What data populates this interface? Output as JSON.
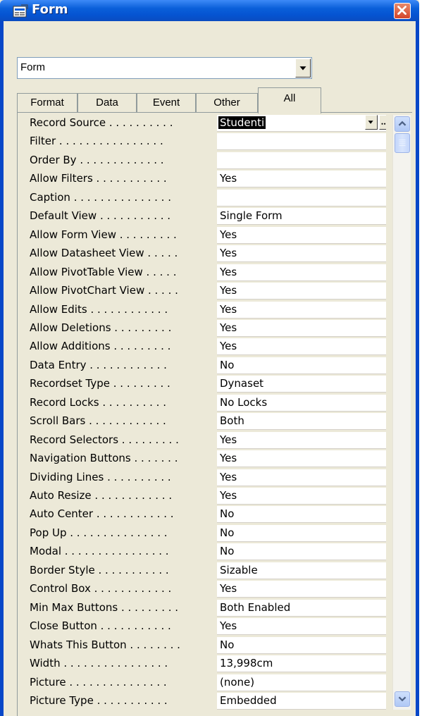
{
  "window": {
    "title": "Form",
    "icon": "form-icon",
    "close_icon": "close-icon"
  },
  "selector": {
    "value": "Form"
  },
  "tabs": [
    {
      "label": "Format",
      "active": false
    },
    {
      "label": "Data",
      "active": false
    },
    {
      "label": "Event",
      "active": false
    },
    {
      "label": "Other",
      "active": false
    },
    {
      "label": "All",
      "active": true
    }
  ],
  "properties": [
    {
      "label": "Record Source . . . . . . . . . .",
      "value": "Studenti",
      "selected": true
    },
    {
      "label": "Filter . . . . . . . . . . . . . . . .",
      "value": ""
    },
    {
      "label": "Order By . . . . . . . . . . . . .",
      "value": ""
    },
    {
      "label": "Allow Filters . . . . . . . . . . .",
      "value": "Yes"
    },
    {
      "label": "Caption . . . . . . . . . . . . . . .",
      "value": ""
    },
    {
      "label": "Default View . . . . . . . . . . .",
      "value": "Single Form"
    },
    {
      "label": "Allow Form View . . . . . . . . .",
      "value": "Yes"
    },
    {
      "label": "Allow Datasheet View . . . . .",
      "value": "Yes"
    },
    {
      "label": "Allow PivotTable View . . . . .",
      "value": "Yes"
    },
    {
      "label": "Allow PivotChart View . . . . .",
      "value": "Yes"
    },
    {
      "label": "Allow Edits . . . . . . . . . . . .",
      "value": "Yes"
    },
    {
      "label": "Allow Deletions . . . . . . . . .",
      "value": "Yes"
    },
    {
      "label": "Allow Additions . . . . . . . . .",
      "value": "Yes"
    },
    {
      "label": "Data Entry . . . . . . . . . . . .",
      "value": "No"
    },
    {
      "label": "Recordset Type . . . . . . . . .",
      "value": "Dynaset"
    },
    {
      "label": "Record Locks . . . . . . . . . .",
      "value": "No Locks"
    },
    {
      "label": "Scroll Bars . . . . . . . . . . . .",
      "value": "Both"
    },
    {
      "label": "Record Selectors . . . . . . . . .",
      "value": "Yes"
    },
    {
      "label": "Navigation Buttons . . . . . . .",
      "value": "Yes"
    },
    {
      "label": "Dividing Lines . . . . . . . . . .",
      "value": "Yes"
    },
    {
      "label": "Auto Resize . . . . . . . . . . . .",
      "value": "Yes"
    },
    {
      "label": "Auto Center . . . . . . . . . . . .",
      "value": "No"
    },
    {
      "label": "Pop Up . . . . . . . . . . . . . . .",
      "value": "No"
    },
    {
      "label": "Modal . . . . . . . . . . . . . . . .",
      "value": "No"
    },
    {
      "label": "Border Style . . . . . . . . . . .",
      "value": "Sizable"
    },
    {
      "label": "Control Box . . . . . . . . . . . .",
      "value": "Yes"
    },
    {
      "label": "Min Max Buttons . . . . . . . . .",
      "value": "Both Enabled"
    },
    {
      "label": "Close Button . . . . . . . . . . .",
      "value": "Yes"
    },
    {
      "label": "Whats This Button . . . . . . . .",
      "value": "No"
    },
    {
      "label": "Width . . . . . . . . . . . . . . . .",
      "value": "13,998cm"
    },
    {
      "label": "Picture . . . . . . . . . . . . . . .",
      "value": "(none)"
    },
    {
      "label": "Picture Type . . . . . . . . . . .",
      "value": "Embedded"
    }
  ],
  "scrollbar": {
    "up_icon": "scroll-up-icon",
    "down_icon": "scroll-down-icon",
    "position": 0
  }
}
